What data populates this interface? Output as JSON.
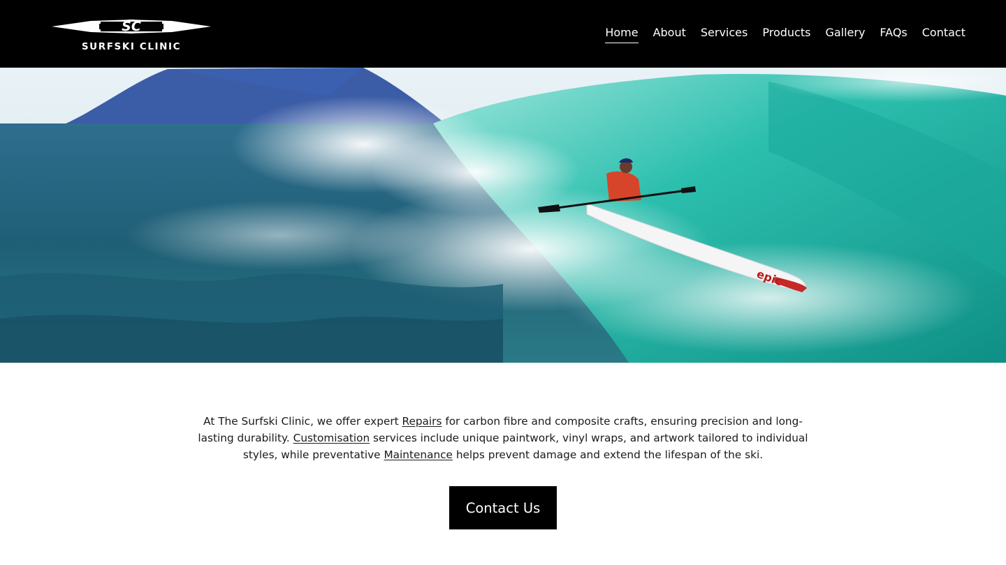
{
  "brand": {
    "logo_text": "SURFSKI CLINIC",
    "logo_mark": "SC"
  },
  "nav": {
    "items": [
      {
        "label": "Home",
        "active": true
      },
      {
        "label": "About"
      },
      {
        "label": "Services"
      },
      {
        "label": "Products"
      },
      {
        "label": "Gallery"
      },
      {
        "label": "FAQs"
      },
      {
        "label": "Contact"
      }
    ]
  },
  "hero": {
    "image": "surfski-paddler-on-wave",
    "ski_brand": "epic"
  },
  "intro": {
    "t1": "At The Surfski Clinic, we offer expert ",
    "link_repairs": "Repairs",
    "t2": " for carbon fibre and composite crafts, ensuring precision and long-lasting durability. ",
    "link_customisation": "Customisation",
    "t3": " services include unique paintwork, vinyl wraps, and artwork tailored to individual styles, while preventative ",
    "link_maintenance": "Maintenance",
    "t4": " helps prevent damage and extend the lifespan of the ski."
  },
  "cta": {
    "label": "Contact Us"
  },
  "colors": {
    "header_bg": "#000000",
    "page_bg": "#ffffff",
    "wave_teal": "#22b8a8",
    "sea_blue": "#2a6f8c",
    "cta_bg": "#000000"
  }
}
